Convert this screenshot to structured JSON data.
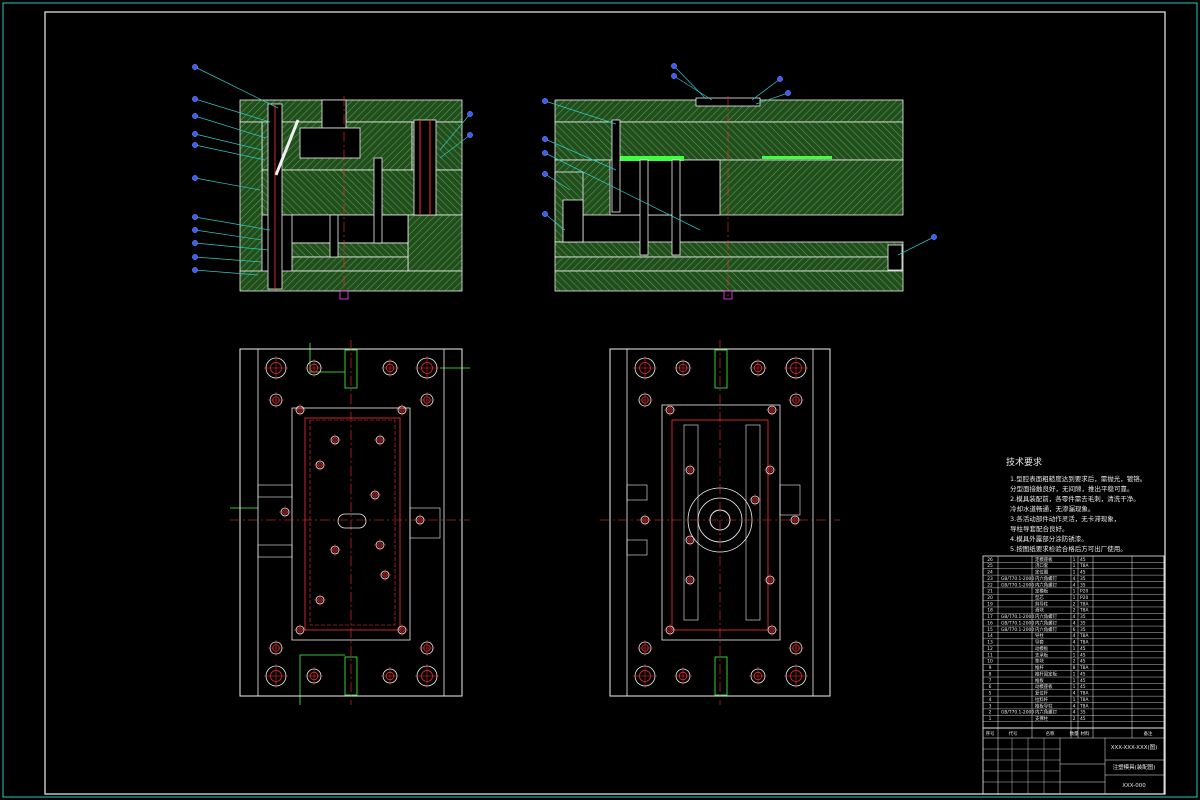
{
  "drawing": {
    "tech_title": "技术要求",
    "tech_notes": [
      "1.型腔表面粗糙度达到要求后，需抛光，镀铬。",
      "  分型面接触良好，无间隙，推出平稳可靠。",
      "2.模具装配前，各零件需去毛刺，清洗干净。",
      "  冷却水道畅通，无渗漏现象。",
      "3.各活动部件动作灵活，无卡滞现象，",
      "  导柱导套配合良好。",
      "4.模具外露部分涂防锈漆。",
      "5.按图纸要求检验合格后方可出厂使用。"
    ],
    "title_block": {
      "drawing_no": "XXX-XXX-XXX(图)",
      "name": "注塑模具(装配图)",
      "code": "XXX-000",
      "row_labels": [
        "序号",
        "代号",
        "名称",
        "数量",
        "材料",
        "备注"
      ]
    },
    "parts": [
      [
        "26",
        "",
        "定模座板",
        "1",
        "45",
        ""
      ],
      [
        "25",
        "",
        "浇口套",
        "1",
        "T8A",
        ""
      ],
      [
        "24",
        "",
        "定位圈",
        "1",
        "45",
        ""
      ],
      [
        "23",
        "GB/T70.1-2000",
        "内六角螺钉",
        "4",
        "35",
        ""
      ],
      [
        "22",
        "GB/T70.1-2000",
        "内六角螺钉",
        "4",
        "35",
        ""
      ],
      [
        "21",
        "",
        "定模板",
        "1",
        "P20",
        ""
      ],
      [
        "20",
        "",
        "型芯",
        "1",
        "P20",
        ""
      ],
      [
        "19",
        "",
        "斜导柱",
        "2",
        "T8A",
        ""
      ],
      [
        "18",
        "",
        "滑块",
        "2",
        "T8A",
        ""
      ],
      [
        "17",
        "GB/T70.1-2000",
        "内六角螺钉",
        "4",
        "35",
        ""
      ],
      [
        "16",
        "GB/T70.1-2000",
        "内六角螺钉",
        "4",
        "35",
        ""
      ],
      [
        "15",
        "GB/T70.1-2000",
        "内六角螺钉",
        "6",
        "35",
        ""
      ],
      [
        "14",
        "",
        "导柱",
        "4",
        "T8A",
        ""
      ],
      [
        "13",
        "",
        "导套",
        "4",
        "T8A",
        ""
      ],
      [
        "12",
        "",
        "动模板",
        "1",
        "45",
        ""
      ],
      [
        "11",
        "",
        "支承板",
        "1",
        "45",
        ""
      ],
      [
        "10",
        "",
        "垫块",
        "2",
        "45",
        ""
      ],
      [
        "9",
        "",
        "推杆",
        "8",
        "T8A",
        ""
      ],
      [
        "8",
        "",
        "推杆固定板",
        "1",
        "45",
        ""
      ],
      [
        "7",
        "",
        "推板",
        "1",
        "45",
        ""
      ],
      [
        "6",
        "",
        "动模座板",
        "1",
        "45",
        ""
      ],
      [
        "5",
        "",
        "复位杆",
        "4",
        "T8A",
        ""
      ],
      [
        "4",
        "",
        "拉料杆",
        "1",
        "T8A",
        ""
      ],
      [
        "3",
        "",
        "推板导柱",
        "4",
        "T8A",
        ""
      ],
      [
        "2",
        "GB/T70.1-2000",
        "内六角螺钉",
        "4",
        "35",
        ""
      ],
      [
        "1",
        "",
        "支撑柱",
        "2",
        "45",
        ""
      ]
    ]
  },
  "colors": {
    "frame": "#1ec8c8",
    "hatch": "#2e8b2e",
    "outline": "#f0f0f0",
    "center": "#ff3030",
    "leader": "#2ec8c8",
    "balloon": "#3a5aff",
    "accent": "#40ff40",
    "magenta": "#ff40ff"
  }
}
